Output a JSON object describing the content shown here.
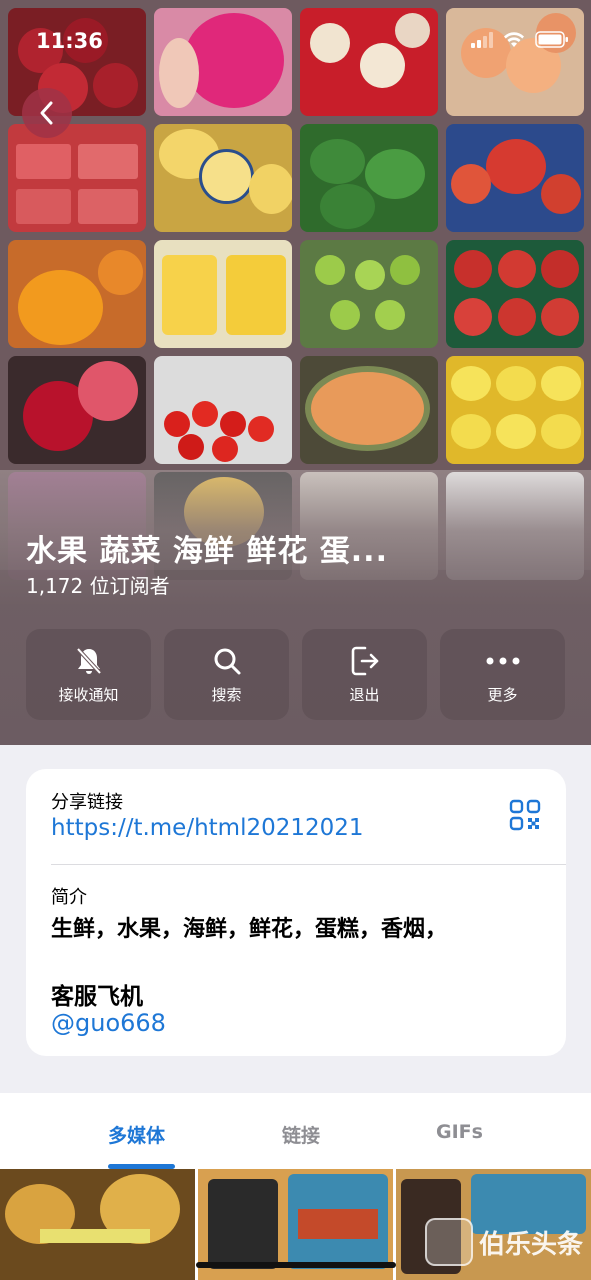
{
  "status": {
    "time": "11:36"
  },
  "channel": {
    "title": "水果 蔬菜 海鲜 鲜花 蛋...",
    "subscribers": "1,172 位订阅者"
  },
  "actions": [
    {
      "label": "接收通知",
      "icon": "bell-slash-icon"
    },
    {
      "label": "搜索",
      "icon": "search-icon"
    },
    {
      "label": "退出",
      "icon": "leave-icon"
    },
    {
      "label": "更多",
      "icon": "more-icon"
    }
  ],
  "info": {
    "share_label": "分享链接",
    "share_url": "https://t.me/html20212021",
    "intro_label": "简介",
    "intro_text": "生鲜，水果，海鲜，鲜花，蛋糕，香烟，",
    "service_label": "客服飞机",
    "service_handle": "@guo668"
  },
  "tabs": [
    {
      "label": "多媒体",
      "active": true
    },
    {
      "label": "链接",
      "active": false
    },
    {
      "label": "GIFs",
      "active": false
    }
  ],
  "watermark": {
    "text": "伯乐头条"
  },
  "colors": {
    "accent": "#1e77d6",
    "back_button": "#a03246"
  }
}
